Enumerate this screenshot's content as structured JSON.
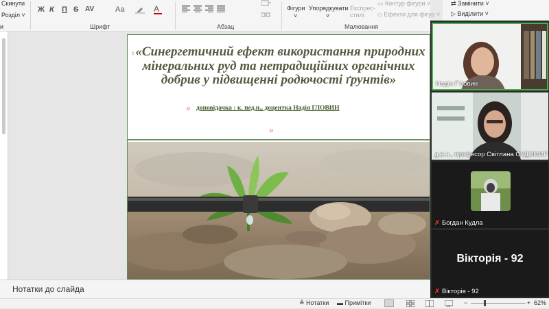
{
  "ribbon": {
    "reset_label": "Скинути",
    "section_label": "Розділ",
    "font_group_label": "Шрифт",
    "paragraph_group_label": "Абзац",
    "drawing_group_label": "Малювання",
    "font_buttons": [
      "Ж",
      "К",
      "П",
      "S",
      "AV",
      "Aa"
    ],
    "shapes_label": "Фігури",
    "arrange_label": "Упорядкувати",
    "quick_styles_label": "Експрес-стилі",
    "shape_outline_label": "Контур фігури",
    "shape_effects_label": "Ефекти для фігур",
    "replace_label": "Замінити",
    "select_label": "Виділити"
  },
  "slide": {
    "title_lead": ":",
    "title": "«Синергетичний ефект використання природних мінеральних руд та нетрадиційних органічних добрив у підвищенні родючості ґрунтів»",
    "speaker": "доповідачка : к. пед.н., доцентка Надія ГЛОВИН",
    "red_marker": "о"
  },
  "notes": {
    "label": "Нотатки до слайда"
  },
  "statusbar": {
    "notes_label": "Нотатки",
    "comments_label": "Примітки",
    "zoom_value": "62%",
    "zoom_minus": "−",
    "zoom_plus": "+"
  },
  "participants": [
    {
      "name": "Надія Г'ловин",
      "muted": false
    },
    {
      "name": "д.е.н., професор Світлана СУДОМИР",
      "muted": false
    },
    {
      "name": "Богдан Кудла",
      "muted": true
    },
    {
      "name": "Вікторія - 92",
      "muted": true,
      "big_label": "Вікторія - 92"
    }
  ],
  "colors": {
    "title_text": "#555a40",
    "slide_border": "#5f8a5a",
    "speaking_border": "#4caf50",
    "muted_mic": "#e0392b"
  }
}
